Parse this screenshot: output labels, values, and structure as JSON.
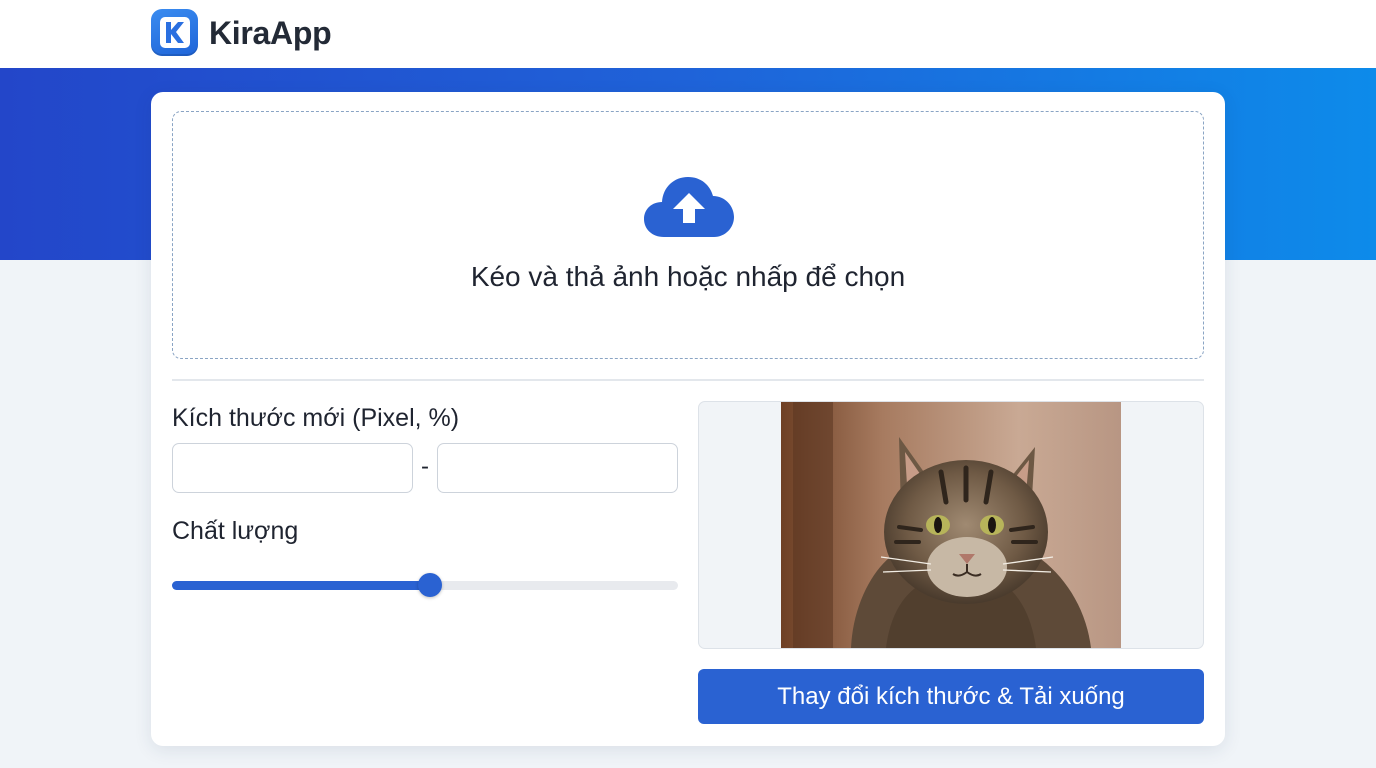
{
  "app": {
    "name": "KiraApp"
  },
  "upload": {
    "prompt": "Kéo và thả ảnh hoặc nhấp để chọn",
    "icon": "cloud-upload-icon"
  },
  "settings": {
    "size_label": "Kích thước mới (Pixel, %)",
    "width_value": "",
    "height_value": "",
    "separator": "-",
    "quality_label": "Chất lượng",
    "quality_value": 0.51
  },
  "preview": {
    "subject": "tabby cat photo"
  },
  "actions": {
    "resize_download_label": "Thay đổi kích thước & Tải xuống"
  },
  "colors": {
    "accent": "#2a62d2",
    "hero_gradient_start": "#2346c9",
    "hero_gradient_end": "#0d8bea",
    "page_background": "#f0f4f8"
  }
}
